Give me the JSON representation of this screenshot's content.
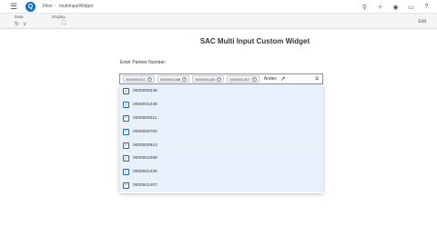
{
  "shell": {
    "menu_icon": "hamburger-icon",
    "logo_text": "Q",
    "breadcrumb": [
      "Files",
      "multiInputWidget"
    ],
    "breadcrumb_sep": "›",
    "right_icons": [
      "search-icon",
      "lightbulb-icon",
      "notification-icon",
      "chat-icon",
      "help-icon"
    ]
  },
  "toolbar": {
    "data_label": "Data",
    "display_label": "Display",
    "edit_label": "Edit"
  },
  "page": {
    "title": "SAC Multi Input Custom Widget",
    "prompt": "Enter Partner Number:"
  },
  "multi_input": {
    "tokens": [
      "0000000011",
      "0000001088",
      "0000001430",
      "0000001307"
    ],
    "typed_value": "Andex"
  },
  "suggestions": {
    "items": [
      {
        "label": "0000000236",
        "checked": true
      },
      {
        "label": "0000001238",
        "checked": true
      },
      {
        "label": "0000000011",
        "checked": true
      },
      {
        "label": "0000000700",
        "checked": true
      },
      {
        "label": "0000000910",
        "checked": true
      },
      {
        "label": "0000001088",
        "checked": true
      },
      {
        "label": "0000001430",
        "checked": true
      },
      {
        "label": "0000001407",
        "checked": true
      }
    ]
  }
}
